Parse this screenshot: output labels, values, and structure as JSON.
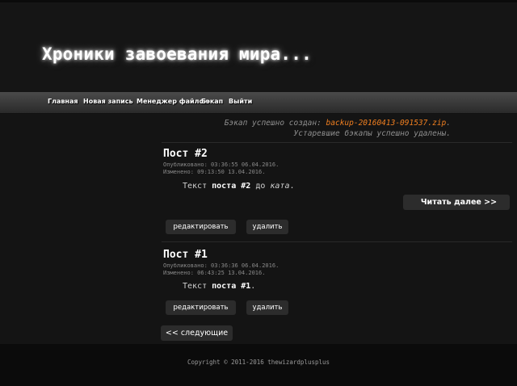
{
  "site": {
    "title": "Хроники завоевания мира..."
  },
  "nav": {
    "items": [
      {
        "label": "Главная"
      },
      {
        "label": "Новая запись"
      },
      {
        "label": "Менеджер файлов"
      },
      {
        "label": "Бэкап"
      },
      {
        "label": "Выйти"
      }
    ]
  },
  "flash": {
    "created_prefix": "Бэкап успешно создан: ",
    "filename": "backup-20160413-091537.zip",
    "created_suffix": ".",
    "deleted": "Устаревшие бэкапы успешно удалены."
  },
  "posts": [
    {
      "title": "Пост #2",
      "published": "Опубликовано: 03:36:55 06.04.2016.",
      "modified": "Изменено: 09:13:50 13.04.2016.",
      "text_prefix": "Текст ",
      "text_bold": "поста #2",
      "text_mid": " до ",
      "text_italic": "ката",
      "text_suffix": ".",
      "read_more": "Читать далее >>",
      "edit": "редактировать",
      "delete": "удалить"
    },
    {
      "title": "Пост #1",
      "published": "Опубликовано: 03:36:36 06.04.2016.",
      "modified": "Изменено: 06:43:25 13.04.2016.",
      "text_prefix": "Текст ",
      "text_bold": "поста #1",
      "text_suffix": ".",
      "edit": "редактировать",
      "delete": "удалить"
    }
  ],
  "pagination": {
    "next": "<< следующие"
  },
  "footer": {
    "copyright": "Copyright © 2011-2016 thewizardplusplus"
  },
  "colors": {
    "accent": "#f07f20",
    "background": "#141414",
    "navbar": "#3a3a3a"
  }
}
